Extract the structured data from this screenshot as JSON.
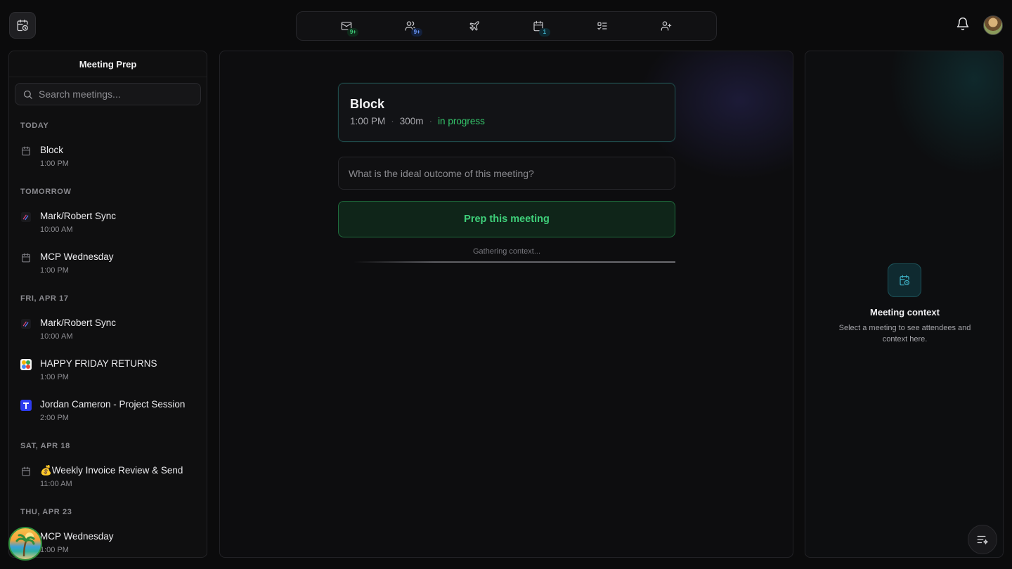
{
  "topnav": {
    "items": [
      {
        "icon": "mail-icon",
        "badge": "9+",
        "badge_color": "#3fcf7a"
      },
      {
        "icon": "users-icon",
        "badge": "9+",
        "badge_color": "#6f9cff"
      },
      {
        "icon": "plane-icon",
        "badge": null
      },
      {
        "icon": "calendar-icon",
        "badge": "1",
        "badge_color": "#42b7d0"
      },
      {
        "icon": "checklist-icon",
        "badge": null
      },
      {
        "icon": "user-plus-icon",
        "badge": null
      }
    ]
  },
  "left": {
    "title": "Meeting Prep",
    "search_placeholder": "Search meetings...",
    "groups": [
      {
        "label": "TODAY",
        "meetings": [
          {
            "title": "Block",
            "time": "1:00 PM",
            "icon": "calendar-icon"
          }
        ]
      },
      {
        "label": "TOMORROW",
        "meetings": [
          {
            "title": "Mark/Robert Sync",
            "time": "10:00 AM",
            "icon": "linear-logo-icon"
          },
          {
            "title": "MCP Wednesday",
            "time": "1:00 PM",
            "icon": "calendar-icon"
          }
        ]
      },
      {
        "label": "FRI, APR 17",
        "meetings": [
          {
            "title": "Mark/Robert Sync",
            "time": "10:00 AM",
            "icon": "linear-logo-icon"
          },
          {
            "title": "HAPPY FRIDAY RETURNS",
            "time": "1:00 PM",
            "icon": "colorful-app-icon"
          },
          {
            "title": "Jordan Cameron - Project Session",
            "time": "2:00 PM",
            "icon": "t-logo-icon"
          }
        ]
      },
      {
        "label": "SAT, APR 18",
        "meetings": [
          {
            "title": "💰Weekly Invoice Review & Send",
            "time": "11:00 AM",
            "icon": "calendar-icon"
          }
        ]
      },
      {
        "label": "THU, APR 23",
        "meetings": [
          {
            "title": "MCP Wednesday",
            "time": "1:00 PM",
            "icon": "calendar-icon"
          }
        ]
      }
    ]
  },
  "center": {
    "meeting_title": "Block",
    "time": "1:00 PM",
    "duration": "300m",
    "status": "in progress",
    "status_color": "#35c66b",
    "goal_placeholder": "What is the ideal outcome of this meeting?",
    "prep_button": "Prep this meeting",
    "gathering_text": "Gathering context..."
  },
  "right": {
    "title": "Meeting context",
    "description": "Select a meeting to see attendees and context here."
  }
}
